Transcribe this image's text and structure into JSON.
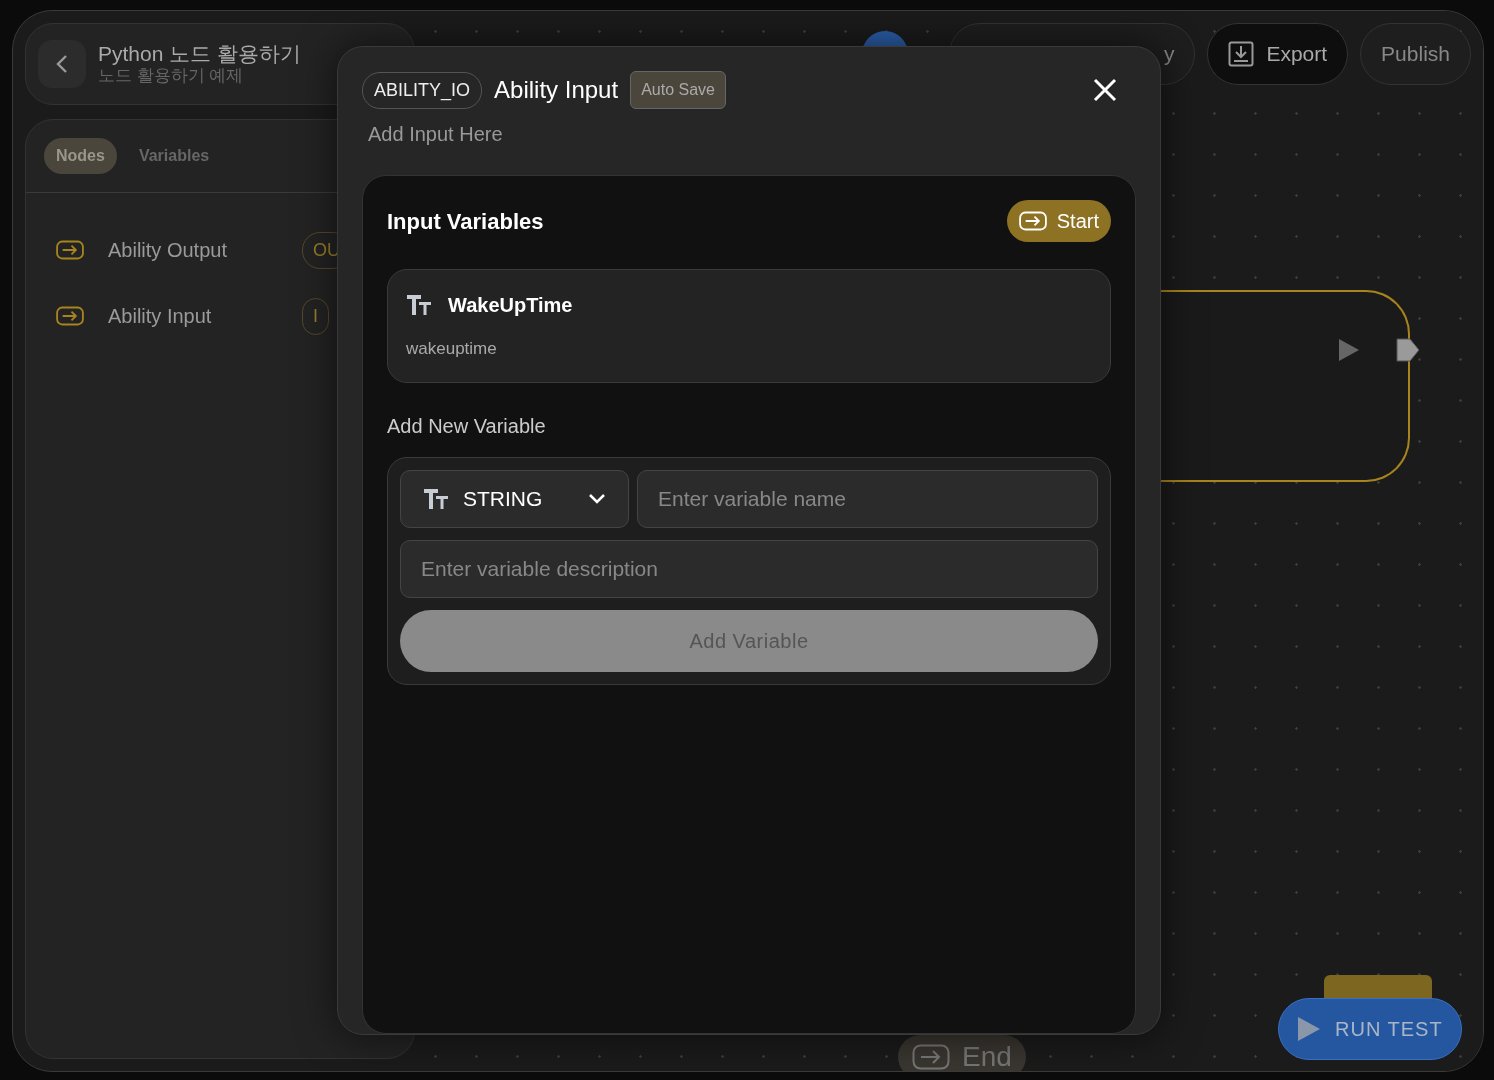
{
  "header": {
    "title": "Python 노드 활용하기",
    "subtitle": "노드 활용하기 예제"
  },
  "sidebar": {
    "tabs": [
      {
        "label": "Nodes",
        "selected": true
      },
      {
        "label": "Variables",
        "selected": false
      }
    ],
    "items": [
      {
        "label": "Ability Output",
        "badge": "OU"
      },
      {
        "label": "Ability Input",
        "badge": "I"
      }
    ]
  },
  "toolbar": {
    "hidden_button": "y",
    "buttons": [
      {
        "label": "Export",
        "kind": "export"
      },
      {
        "label": "Publish",
        "kind": "publish"
      }
    ]
  },
  "canvas": {
    "end_node": "End",
    "run_test": "RUN TEST"
  },
  "modal": {
    "type_tag": "ABILITY_IO",
    "title": "Ability Input",
    "auto_save": "Auto Save",
    "description": "Add Input Here",
    "section_title": "Input Variables",
    "start_button": "Start",
    "variables": [
      {
        "name": "WakeUpTime",
        "key": "wakeuptime"
      }
    ],
    "add_title": "Add New Variable",
    "type_select": "STRING",
    "name_placeholder": "Enter variable name",
    "description_placeholder": "Enter variable description",
    "add_button": {
      "label": "Add Variable",
      "disabled": true
    }
  }
}
